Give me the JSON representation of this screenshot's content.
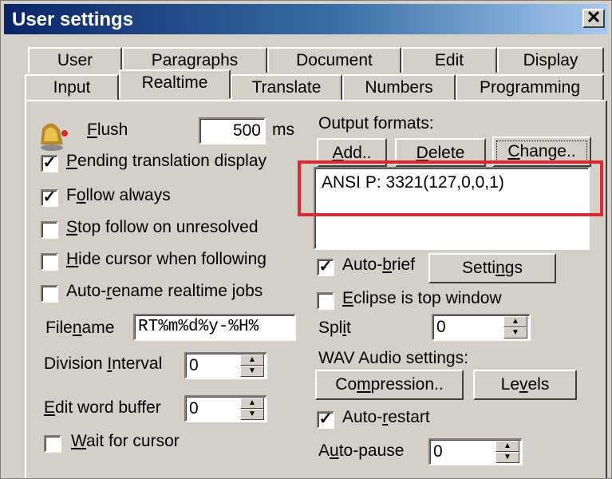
{
  "window": {
    "title": "User settings",
    "close_glyph": "✕"
  },
  "tabs": {
    "back_row": [
      "User",
      "Paragraphs",
      "Document",
      "Edit",
      "Display"
    ],
    "front_row": [
      "Input",
      "Realtime",
      "Translate",
      "Numbers",
      "Programming"
    ],
    "active": "Realtime"
  },
  "left": {
    "flush": {
      "label_pre": "",
      "label_ul": "F",
      "label_post": "lush",
      "value": "500",
      "unit": "ms",
      "icon": "bell-icon"
    },
    "pending": {
      "checked": true,
      "ul": "P",
      "rest": "ending translation display"
    },
    "follow_always": {
      "checked": true,
      "pre": "F",
      "ul": "o",
      "rest": "llow always"
    },
    "stop_follow": {
      "checked": false,
      "ul": "S",
      "rest": "top follow on unresolved"
    },
    "hide_cursor": {
      "checked": false,
      "ul": "H",
      "rest": "ide cursor when following"
    },
    "auto_rename": {
      "checked": false,
      "pre": "Auto-",
      "ul": "r",
      "rest": "ename realtime jobs"
    },
    "filename": {
      "pre": "File",
      "ul": "n",
      "rest": "ame",
      "value": "RT%m%d%y-%H%"
    },
    "division": {
      "pre": "Division ",
      "ul": "I",
      "rest": "nterval",
      "value": "0"
    },
    "edit_buffer": {
      "ul": "E",
      "rest": "dit word buffer",
      "value": "0"
    },
    "wait_cursor": {
      "checked": false,
      "ul": "W",
      "rest": "ait for cursor"
    }
  },
  "right": {
    "output_formats_label": "Output formats:",
    "add_btn": {
      "ul": "A",
      "rest": "dd.."
    },
    "delete_btn": {
      "ul": "D",
      "rest": "elete"
    },
    "change_btn": {
      "ul": "C",
      "rest": "hange.."
    },
    "list_items": [
      "ANSI P: 3321(127,0,0,1)"
    ],
    "auto_brief": {
      "checked": true,
      "pre": "Auto-",
      "ul": "b",
      "rest": "rief"
    },
    "settings_btn": {
      "pre": "Setti",
      "ul": "n",
      "rest": "gs"
    },
    "eclipse_top": {
      "checked": false,
      "ul": "E",
      "rest": "clipse is top window"
    },
    "split": {
      "pre": "Spl",
      "ul": "i",
      "rest": "t",
      "value": "0"
    },
    "wav_label": "WAV Audio settings:",
    "compression_btn": {
      "pre": "Co",
      "ul": "m",
      "rest": "pression.."
    },
    "levels_btn": {
      "pre": "Le",
      "ul": "v",
      "rest": "els"
    },
    "auto_restart": {
      "checked": true,
      "pre": "Auto-",
      "ul": "r",
      "rest": "estart"
    },
    "auto_pause": {
      "pre": "A",
      "ul": "u",
      "rest": "to-pause",
      "value": "0"
    }
  },
  "colors": {
    "highlight": "#e0262e",
    "title_bar_start": "#0a246a",
    "face": "#d4d0c8"
  }
}
